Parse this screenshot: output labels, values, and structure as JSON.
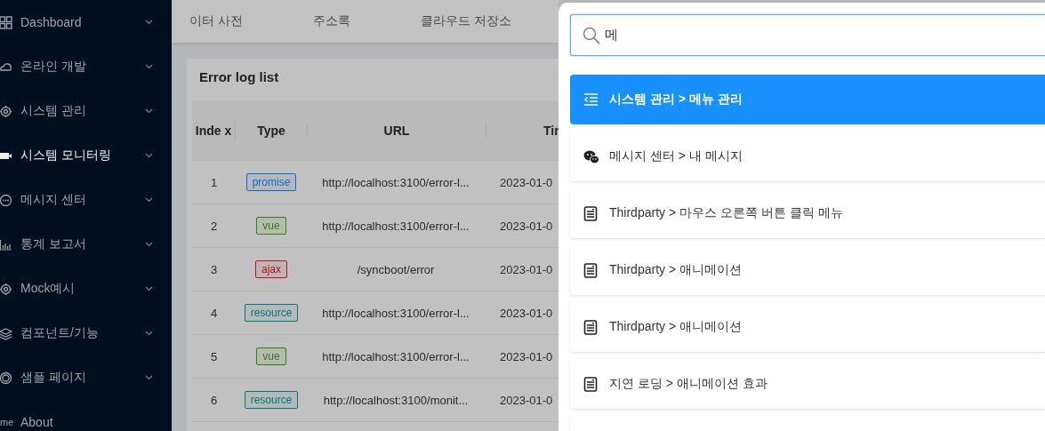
{
  "sidebar": {
    "items": [
      {
        "label": "Dashboard",
        "kind": "grid",
        "selected": false
      },
      {
        "label": "온라인 개발",
        "kind": "cloud",
        "selected": false
      },
      {
        "label": "시스템 관리",
        "kind": "gear",
        "selected": false
      },
      {
        "label": "시스템 모니터링",
        "kind": "camera",
        "selected": true
      },
      {
        "label": "메시지 센터",
        "kind": "chat",
        "selected": false
      },
      {
        "label": "통계 보고서",
        "kind": "chart",
        "selected": false
      },
      {
        "label": "Mock예시",
        "kind": "gear",
        "selected": false
      },
      {
        "label": "컴포넌트/기능",
        "kind": "layers",
        "selected": false
      },
      {
        "label": "샘플 페이지",
        "kind": "ring",
        "selected": false
      },
      {
        "label": "About",
        "kind": "link",
        "icon_text": "me",
        "selected": false
      }
    ]
  },
  "tabs": [
    {
      "label": "이터 사전"
    },
    {
      "label": "주소록"
    },
    {
      "label": "클라우드 저장소"
    }
  ],
  "card": {
    "title": "Error log list",
    "table": {
      "columns": [
        "Inde x",
        "Type",
        "URL",
        "Tir"
      ],
      "rows": [
        {
          "index": "1",
          "type": "promise",
          "color": "#1668c0",
          "url": "http://localhost:3100/error-l...",
          "time": "2023-01-0"
        },
        {
          "index": "2",
          "type": "vue",
          "color": "#3a7d10",
          "url": "http://localhost:3100/error-l...",
          "time": "2023-01-0"
        },
        {
          "index": "3",
          "type": "ajax",
          "color": "#b8141c",
          "url": "/syncboot/error",
          "time": "2023-01-0"
        },
        {
          "index": "4",
          "type": "resource",
          "color": "#0a7478",
          "url": "http://localhost:3100/error-l...",
          "time": "2023-01-0"
        },
        {
          "index": "5",
          "type": "vue",
          "color": "#3a7d10",
          "url": "http://localhost:3100/error-l...",
          "time": "2023-01-0"
        },
        {
          "index": "6",
          "type": "resource",
          "color": "#0a7478",
          "url": "http://localhost:3100/monit...",
          "time": "2023-01-0"
        }
      ]
    }
  },
  "search": {
    "value": "메",
    "results": [
      {
        "kind": "menu",
        "text": "시스템 관리 > 메뉴 관리",
        "selected": true
      },
      {
        "kind": "wechat",
        "text": "메시지 센터 > 내 메시지",
        "selected": false
      },
      {
        "kind": "doc",
        "text": "Thirdparty > 마우스 오른쪽 버튼 클릭 메뉴",
        "selected": false
      },
      {
        "kind": "doc",
        "text": "Thirdparty > 애니메이션",
        "selected": false
      },
      {
        "kind": "doc",
        "text": "Thirdparty > 애니메이션",
        "selected": false
      },
      {
        "kind": "doc",
        "text": "지연 로딩 > 애니메이션 효과",
        "selected": false
      }
    ]
  }
}
